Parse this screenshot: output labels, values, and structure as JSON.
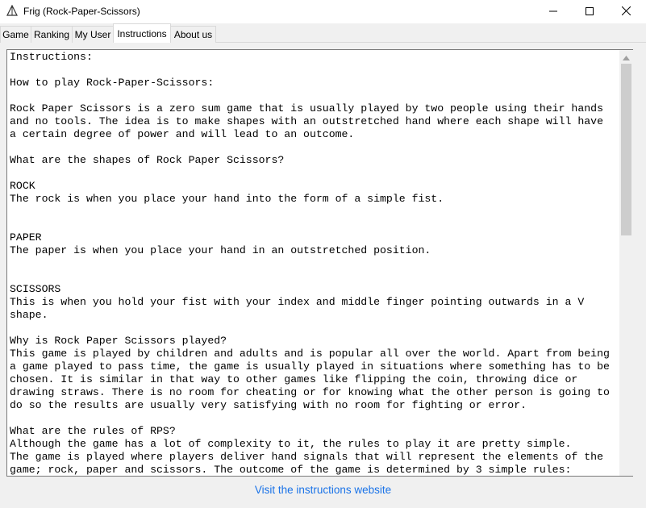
{
  "window": {
    "title": "Frig (Rock-Paper-Scissors)",
    "icon": "app-triangle-icon",
    "controls": [
      "minimize-icon",
      "maximize-icon",
      "close-icon"
    ]
  },
  "tabs": [
    {
      "label": "Game"
    },
    {
      "label": "Ranking"
    },
    {
      "label": "My User"
    },
    {
      "label": "Instructions",
      "active": true
    },
    {
      "label": "About us"
    }
  ],
  "instructions": {
    "text": "Instructions:\n\nHow to play Rock-Paper-Scissors:\n\nRock Paper Scissors is a zero sum game that is usually played by two people using their hands\nand no tools. The idea is to make shapes with an outstretched hand where each shape will have\na certain degree of power and will lead to an outcome.\n\nWhat are the shapes of Rock Paper Scissors?\n\nROCK\nThe rock is when you place your hand into the form of a simple fist.\n\n\nPAPER\nThe paper is when you place your hand in an outstretched position.\n\n\nSCISSORS\nThis is when you hold your fist with your index and middle finger pointing outwards in a V\nshape.\n\nWhy is Rock Paper Scissors played?\nThis game is played by children and adults and is popular all over the world. Apart from being\na game played to pass time, the game is usually played in situations where something has to be\nchosen. It is similar in that way to other games like flipping the coin, throwing dice or\ndrawing straws. There is no room for cheating or for knowing what the other person is going to\ndo so the results are usually very satisfying with no room for fighting or error.\n\nWhat are the rules of RPS?\nAlthough the game has a lot of complexity to it, the rules to play it are pretty simple.\nThe game is played where players deliver hand signals that will represent the elements of the\ngame; rock, paper and scissors. The outcome of the game is determined by 3 simple rules:"
  },
  "footer": {
    "link_label": "Visit the instructions website"
  },
  "colors": {
    "link": "#1a73e8",
    "tab_bg": "#f0f0f0",
    "scroll_thumb": "#cdcdcd"
  }
}
